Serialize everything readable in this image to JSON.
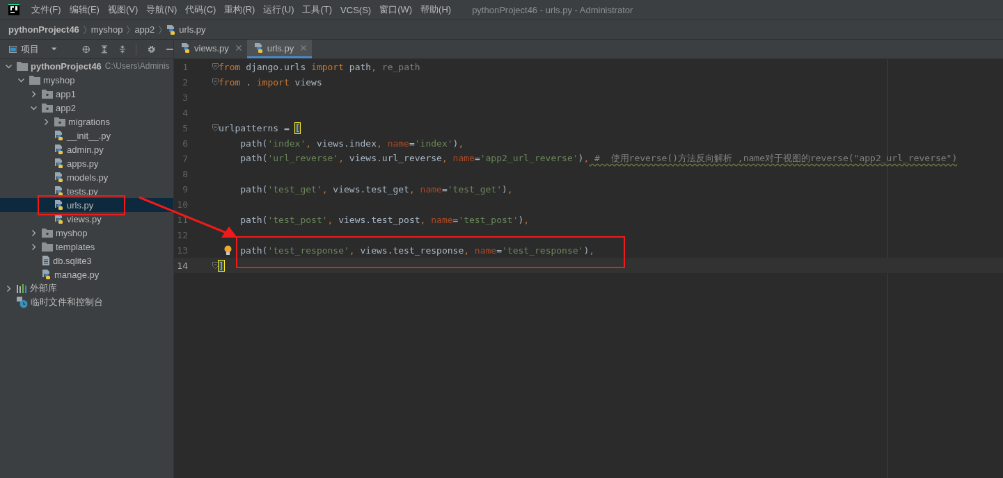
{
  "menu": [
    "文件(F)",
    "编辑(E)",
    "视图(V)",
    "导航(N)",
    "代码(C)",
    "重构(R)",
    "运行(U)",
    "工具(T)",
    "VCS(S)",
    "窗口(W)",
    "帮助(H)"
  ],
  "window_title": "pythonProject46 - urls.py - Administrator",
  "breadcrumb": [
    {
      "label": "pythonProject46",
      "kind": "project"
    },
    {
      "label": "myshop",
      "kind": "dir"
    },
    {
      "label": "app2",
      "kind": "dir"
    },
    {
      "label": "urls.py",
      "kind": "pyfile"
    }
  ],
  "project_panel": {
    "title": "项目",
    "tree": [
      {
        "label": "pythonProject46",
        "hint": "C:\\Users\\Adminis",
        "kind": "folder",
        "expanded": true,
        "selected": false,
        "children": [
          {
            "label": "myshop",
            "kind": "folder",
            "expanded": true,
            "selected": false,
            "children": [
              {
                "label": "app1",
                "kind": "module",
                "expanded": false,
                "selected": false
              },
              {
                "label": "app2",
                "kind": "module",
                "expanded": true,
                "selected": false,
                "children": [
                  {
                    "label": "migrations",
                    "kind": "module",
                    "expanded": false,
                    "selected": false
                  },
                  {
                    "label": "__init__.py",
                    "kind": "pyfile",
                    "selected": false
                  },
                  {
                    "label": "admin.py",
                    "kind": "pyfile",
                    "selected": false
                  },
                  {
                    "label": "apps.py",
                    "kind": "pyfile",
                    "selected": false
                  },
                  {
                    "label": "models.py",
                    "kind": "pyfile",
                    "selected": false
                  },
                  {
                    "label": "tests.py",
                    "kind": "pyfile",
                    "selected": false
                  },
                  {
                    "label": "urls.py",
                    "kind": "pyfile",
                    "selected": true
                  },
                  {
                    "label": "views.py",
                    "kind": "pyfile",
                    "selected": false
                  }
                ]
              },
              {
                "label": "myshop",
                "kind": "module",
                "expanded": false,
                "selected": false
              },
              {
                "label": "templates",
                "kind": "folder",
                "expanded": false,
                "selected": false
              },
              {
                "label": "db.sqlite3",
                "kind": "file",
                "selected": false
              },
              {
                "label": "manage.py",
                "kind": "pyfile",
                "selected": false
              }
            ]
          }
        ]
      },
      {
        "label": "外部库",
        "kind": "library",
        "expanded": false,
        "selected": false
      },
      {
        "label": "临时文件和控制台",
        "kind": "scratch",
        "selected": false
      }
    ]
  },
  "tabs": [
    {
      "label": "views.py",
      "selected": false
    },
    {
      "label": "urls.py",
      "selected": true
    }
  ],
  "editor": {
    "lines": [
      {
        "number": "1",
        "fold": true,
        "current": false,
        "bulb": false,
        "tokens": [
          {
            "kind": "kw",
            "t": "from"
          },
          {
            "kind": "plain",
            "t": " django.urls "
          },
          {
            "kind": "kw",
            "t": "import"
          },
          {
            "kind": "plain",
            "t": " path"
          },
          {
            "kind": "kw",
            "t": ","
          },
          {
            "kind": "dim",
            "t": " re_path"
          }
        ]
      },
      {
        "number": "2",
        "fold": true,
        "current": false,
        "bulb": false,
        "tokens": [
          {
            "kind": "kw",
            "t": "from"
          },
          {
            "kind": "plain",
            "t": " . "
          },
          {
            "kind": "kw",
            "t": "import"
          },
          {
            "kind": "plain",
            "t": " views"
          }
        ]
      },
      {
        "number": "3",
        "fold": false,
        "current": false,
        "bulb": false
      },
      {
        "number": "4",
        "fold": false,
        "current": false,
        "bulb": false
      },
      {
        "number": "5",
        "fold": true,
        "current": false,
        "bulb": false,
        "tokens": [
          {
            "kind": "plain",
            "t": "urlpatterns = "
          },
          {
            "kind": "brace",
            "t": "["
          }
        ]
      },
      {
        "number": "6",
        "fold": false,
        "current": false,
        "bulb": false,
        "indented": true,
        "tokens": [
          {
            "kind": "plain",
            "t": "path("
          },
          {
            "kind": "str",
            "t": "'index'"
          },
          {
            "kind": "kw",
            "t": ","
          },
          {
            "kind": "plain",
            "t": " views.index"
          },
          {
            "kind": "kw",
            "t": ","
          },
          {
            "kind": "param",
            "t": " name"
          },
          {
            "kind": "plain",
            "t": "="
          },
          {
            "kind": "str",
            "t": "'index'"
          },
          {
            "kind": "plain",
            "t": ")"
          },
          {
            "kind": "kw",
            "t": ","
          }
        ]
      },
      {
        "number": "7",
        "fold": false,
        "current": false,
        "bulb": false,
        "indented": true,
        "tokens": [
          {
            "kind": "plain",
            "t": "path("
          },
          {
            "kind": "str",
            "t": "'url_reverse'"
          },
          {
            "kind": "kw",
            "t": ","
          },
          {
            "kind": "plain",
            "t": " views.url_reverse"
          },
          {
            "kind": "kw",
            "t": ","
          },
          {
            "kind": "param",
            "t": " name"
          },
          {
            "kind": "plain",
            "t": "="
          },
          {
            "kind": "str",
            "t": "'app2_url_reverse'"
          },
          {
            "kind": "plain",
            "t": ")"
          },
          {
            "kind": "kw",
            "t": ","
          },
          {
            "kind": "comment",
            "t": " #  使用reverse()方法反向解析 ,name对于视图的reverse(\"app2_url_reverse\")"
          }
        ]
      },
      {
        "number": "8",
        "fold": false,
        "current": false,
        "bulb": false
      },
      {
        "number": "9",
        "fold": false,
        "current": false,
        "bulb": false,
        "indented": true,
        "tokens": [
          {
            "kind": "plain",
            "t": "path("
          },
          {
            "kind": "str",
            "t": "'test_get'"
          },
          {
            "kind": "kw",
            "t": ","
          },
          {
            "kind": "plain",
            "t": " views.test_get"
          },
          {
            "kind": "kw",
            "t": ","
          },
          {
            "kind": "param",
            "t": " name"
          },
          {
            "kind": "plain",
            "t": "="
          },
          {
            "kind": "str",
            "t": "'test_get'"
          },
          {
            "kind": "plain",
            "t": ")"
          },
          {
            "kind": "kw",
            "t": ","
          }
        ]
      },
      {
        "number": "10",
        "fold": false,
        "current": false,
        "bulb": false
      },
      {
        "number": "11",
        "fold": false,
        "current": false,
        "bulb": false,
        "indented": true,
        "tokens": [
          {
            "kind": "plain",
            "t": "path("
          },
          {
            "kind": "str",
            "t": "'test_post'"
          },
          {
            "kind": "kw",
            "t": ","
          },
          {
            "kind": "plain",
            "t": " views.test_post"
          },
          {
            "kind": "kw",
            "t": ","
          },
          {
            "kind": "param",
            "t": " name"
          },
          {
            "kind": "plain",
            "t": "="
          },
          {
            "kind": "str",
            "t": "'test_post'"
          },
          {
            "kind": "plain",
            "t": ")"
          },
          {
            "kind": "kw",
            "t": ","
          }
        ]
      },
      {
        "number": "12",
        "fold": false,
        "current": false,
        "bulb": false
      },
      {
        "number": "13",
        "fold": false,
        "current": false,
        "bulb": true,
        "indented": true,
        "tokens": [
          {
            "kind": "plain",
            "t": "path("
          },
          {
            "kind": "str",
            "t": "'test_response'"
          },
          {
            "kind": "kw",
            "t": ","
          },
          {
            "kind": "plain",
            "t": " views.test_response"
          },
          {
            "kind": "kw",
            "t": ","
          },
          {
            "kind": "param",
            "t": " name"
          },
          {
            "kind": "plain",
            "t": "="
          },
          {
            "kind": "str",
            "t": "'test_response'"
          },
          {
            "kind": "plain",
            "t": ")"
          },
          {
            "kind": "kw",
            "t": ","
          }
        ]
      },
      {
        "number": "14",
        "fold": true,
        "current": true,
        "bulb": false,
        "tokens": [
          {
            "kind": "brace",
            "t": "]"
          }
        ]
      }
    ]
  }
}
